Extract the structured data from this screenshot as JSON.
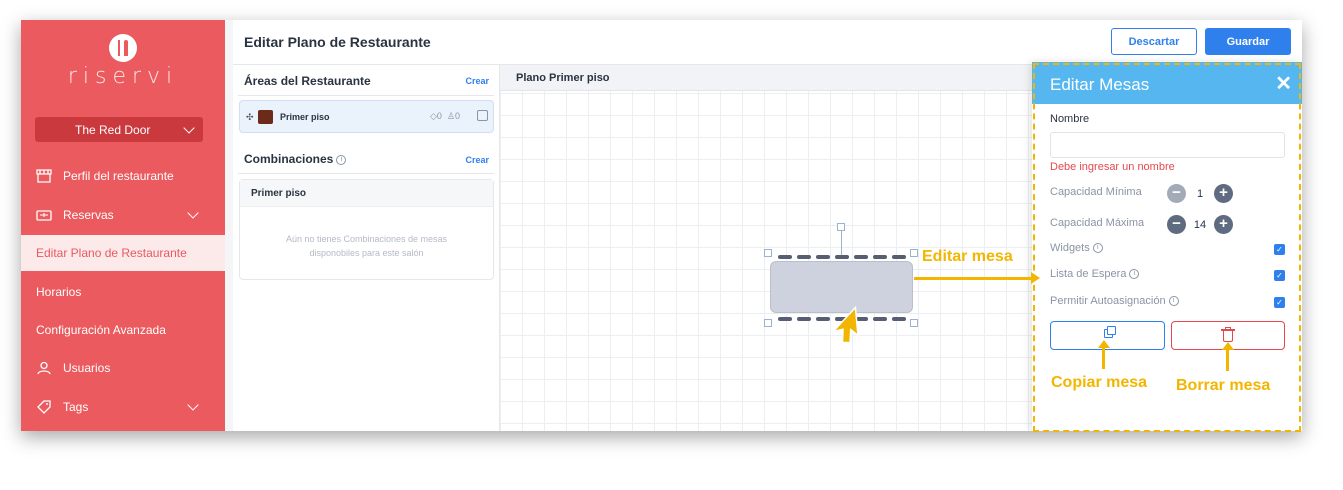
{
  "sidebar": {
    "logo_text": "riservi",
    "restaurant": "The Red Door",
    "items": [
      {
        "label": "Perfil del restaurante",
        "icon": "storefront-icon"
      },
      {
        "label": "Reservas",
        "icon": "ticket-icon",
        "expandable": true
      },
      {
        "label": "Editar Plano de Restaurante",
        "active": true
      },
      {
        "label": "Horarios"
      },
      {
        "label": "Configuración Avanzada"
      },
      {
        "label": "Usuarios",
        "icon": "user-icon"
      },
      {
        "label": "Tags",
        "icon": "tag-icon",
        "expandable": true
      }
    ]
  },
  "header": {
    "title": "Editar Plano de Restaurante",
    "discard_label": "Descartar",
    "save_label": "Guardar"
  },
  "areas": {
    "title": "Áreas del Restaurante",
    "create_label": "Crear",
    "items": [
      {
        "name": "Primer piso",
        "tables": "0",
        "seats": "0"
      }
    ]
  },
  "combinations": {
    "title": "Combinaciones",
    "create_label": "Crear",
    "box_title": "Primer piso",
    "empty_text": "Aún no tienes Combinaciones de mesas disponobiles para este salón"
  },
  "canvas": {
    "title": "Plano Primer piso"
  },
  "edit_panel": {
    "title": "Editar Mesas",
    "close": "✕",
    "name_label": "Nombre",
    "name_value": "",
    "name_error": "Debe ingresar un nombre",
    "min_capacity_label": "Capacidad Mínima",
    "min_capacity_value": "1",
    "max_capacity_label": "Capacidad Máxima",
    "max_capacity_value": "14",
    "widgets_label": "Widgets",
    "waitlist_label": "Lista de Espera",
    "autoassign_label": "Permitir Autoasignación",
    "widgets_checked": true,
    "waitlist_checked": true,
    "autoassign_checked": true
  },
  "annotations": {
    "edit_table": "Editar mesa",
    "copy_table": "Copiar mesa",
    "delete_table": "Borrar mesa"
  },
  "colors": {
    "sidebar": "#ea5a5e",
    "primary": "#2f80ed",
    "panel_header": "#56b6ef",
    "annotation": "#f2b600",
    "error": "#e5484d"
  }
}
